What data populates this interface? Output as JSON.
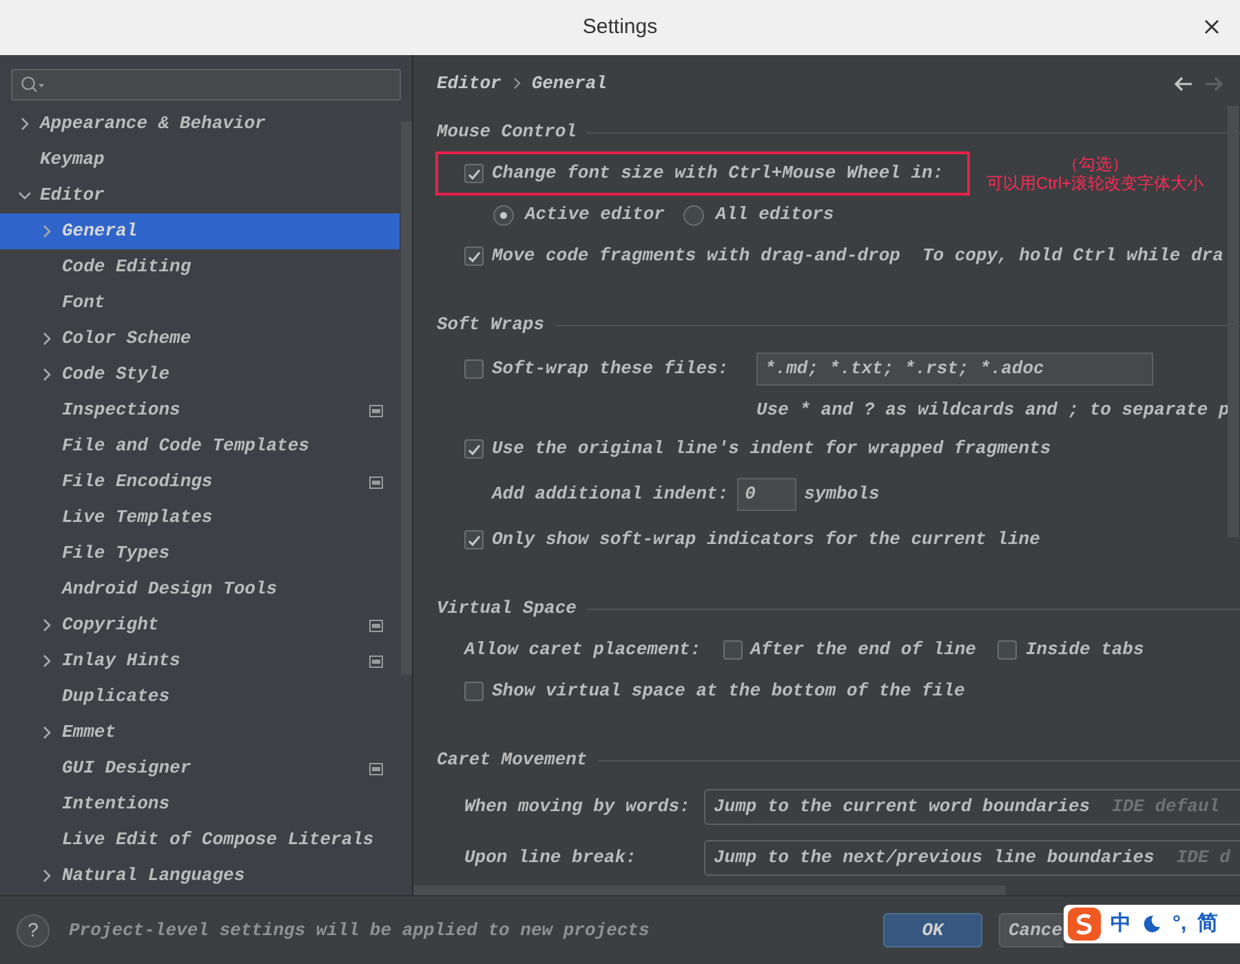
{
  "window": {
    "title": "Settings"
  },
  "sidebar": {
    "tree": [
      {
        "label": "Appearance & Behavior",
        "expanded": false,
        "selected": false,
        "badge": false
      },
      {
        "label": "Keymap",
        "selected": false,
        "badge": false
      },
      {
        "label": "Editor",
        "expanded": true,
        "selected": false,
        "badge": false,
        "children": [
          {
            "label": "General",
            "expanded": false,
            "selected": true,
            "badge": false
          },
          {
            "label": "Code Editing",
            "selected": false,
            "badge": false
          },
          {
            "label": "Font",
            "selected": false,
            "badge": false
          },
          {
            "label": "Color Scheme",
            "expanded": false,
            "selected": false,
            "badge": false
          },
          {
            "label": "Code Style",
            "expanded": false,
            "selected": false,
            "badge": false
          },
          {
            "label": "Inspections",
            "selected": false,
            "badge": true
          },
          {
            "label": "File and Code Templates",
            "selected": false,
            "badge": false
          },
          {
            "label": "File Encodings",
            "selected": false,
            "badge": true
          },
          {
            "label": "Live Templates",
            "selected": false,
            "badge": false
          },
          {
            "label": "File Types",
            "selected": false,
            "badge": false
          },
          {
            "label": "Android Design Tools",
            "selected": false,
            "badge": false
          },
          {
            "label": "Copyright",
            "expanded": false,
            "selected": false,
            "badge": true
          },
          {
            "label": "Inlay Hints",
            "expanded": false,
            "selected": false,
            "badge": true
          },
          {
            "label": "Duplicates",
            "selected": false,
            "badge": false
          },
          {
            "label": "Emmet",
            "expanded": false,
            "selected": false,
            "badge": false
          },
          {
            "label": "GUI Designer",
            "selected": false,
            "badge": true
          },
          {
            "label": "Intentions",
            "selected": false,
            "badge": false
          },
          {
            "label": "Live Edit of Compose Literals",
            "selected": false,
            "badge": false
          },
          {
            "label": "Natural Languages",
            "expanded": false,
            "selected": false,
            "badge": false
          }
        ]
      }
    ]
  },
  "content": {
    "breadcrumb": [
      "Editor",
      "General"
    ],
    "sections": [
      {
        "title": "Mouse Control",
        "rows": [
          {
            "kind": "checkbox",
            "label": "Change font size with Ctrl+Mouse Wheel in:",
            "checked": true,
            "highlighted": true
          },
          {
            "kind": "radios",
            "options": [
              {
                "label": "Active editor",
                "selected": true
              },
              {
                "label": "All editors",
                "selected": false
              }
            ]
          },
          {
            "kind": "checkbox",
            "label": "Move code fragments with drag-and-drop",
            "checked": true,
            "highlighted": false,
            "hint": "To copy, hold Ctrl while dra"
          }
        ]
      },
      {
        "title": "Soft Wraps",
        "rows": [
          {
            "kind": "checkfield",
            "label": "Soft-wrap these files:",
            "checked": false,
            "value": "*.md; *.txt; *.rst; *.adoc"
          },
          {
            "kind": "note",
            "text": "Use * and ? as wildcards and ; to separate p"
          },
          {
            "kind": "checkbox",
            "label": "Use the original line's indent for wrapped fragments",
            "checked": true,
            "highlighted": false
          },
          {
            "kind": "number",
            "label": "Add additional indent:",
            "value": "0",
            "unit": "symbols"
          },
          {
            "kind": "checkbox",
            "label": "Only show soft-wrap indicators for the current line",
            "checked": true,
            "highlighted": false
          }
        ]
      },
      {
        "title": "Virtual Space",
        "rows": [
          {
            "kind": "checkgroup",
            "label": "Allow caret placement:",
            "options": [
              {
                "label": "After the end of line",
                "checked": false
              },
              {
                "label": "Inside tabs",
                "checked": false
              }
            ]
          },
          {
            "kind": "checkbox",
            "label": "Show virtual space at the bottom of the file",
            "checked": false,
            "highlighted": false
          }
        ]
      },
      {
        "title": "Caret Movement",
        "rows": [
          {
            "kind": "combo",
            "label": "When moving by words:",
            "value": "Jump to the current word boundaries",
            "hint": "IDE defaul"
          },
          {
            "kind": "combo",
            "label": "Upon line break:",
            "value": "Jump to the next/previous line boundaries",
            "hint": "IDE d"
          }
        ]
      }
    ],
    "annotation": [
      "（勾选）",
      "可以用Ctrl+滚轮改变字体大小"
    ]
  },
  "footer": {
    "help": "?",
    "note": "Project-level settings will be applied to new projects",
    "buttons": [
      {
        "label": "OK",
        "primary": true
      },
      {
        "label": "Cance",
        "primary": false
      }
    ]
  },
  "ime_toolbar": [
    "中",
    "°,",
    "简"
  ]
}
